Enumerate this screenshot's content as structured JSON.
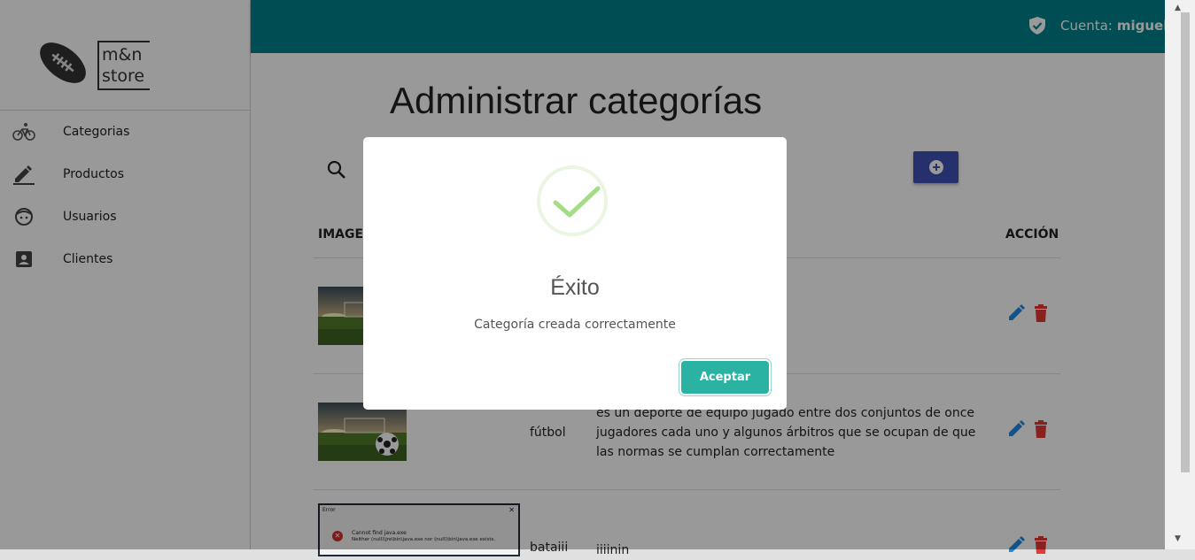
{
  "brand": {
    "line1": "m&n",
    "line2": "store"
  },
  "sidebar": {
    "items": [
      {
        "label": "Categorias",
        "icon": "bicycle-icon"
      },
      {
        "label": "Productos",
        "icon": "pencil-icon"
      },
      {
        "label": "Usuarios",
        "icon": "face-icon"
      },
      {
        "label": "Clientes",
        "icon": "contact-card-icon"
      }
    ]
  },
  "topbar": {
    "account_label": "Cuenta:",
    "account_user": "miguelgr"
  },
  "page": {
    "title": "Administrar categorías"
  },
  "table": {
    "columns": {
      "image": "IMAGEN",
      "action": "ACCIÓN"
    },
    "rows": [
      {
        "name": "",
        "description": ""
      },
      {
        "name": "fútbol",
        "description": "es un deporte de equipo jugado entre dos conjuntos de once jugadores cada uno y algunos árbitros que se ocupan de que las normas se cumplan correctamente"
      },
      {
        "name": "bataiii",
        "description": "iiiinin"
      }
    ]
  },
  "error_thumb": {
    "title": "Error",
    "line1": "Cannot find java.exe",
    "line2": "Neither (null)\\jre\\bin\\java.exe nor (null)\\bin\\java.exe exists."
  },
  "modal": {
    "title": "Éxito",
    "message": "Categoría creada correctamente",
    "confirm_label": "Aceptar"
  },
  "colors": {
    "topbar": "#00838a",
    "accent_button": "#3f51b5",
    "confirm_button": "#2ab3a2",
    "edit": "#1e88e5",
    "delete": "#e53935",
    "success": "#a5dc86"
  }
}
